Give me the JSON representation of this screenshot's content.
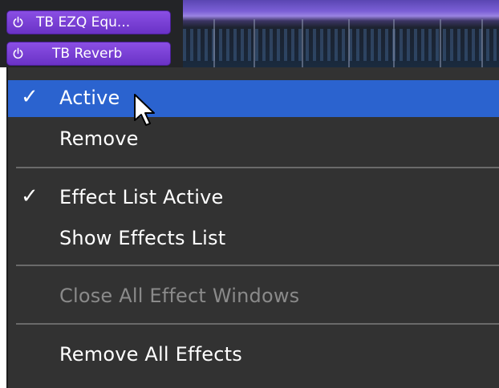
{
  "effect_slots": [
    {
      "name": "TB EZQ Equ...",
      "icon": "power-icon"
    },
    {
      "name": "TB Reverb",
      "icon": "power-icon"
    }
  ],
  "menu": {
    "items": [
      {
        "label": "Active",
        "checked": true,
        "highlighted": true,
        "enabled": true
      },
      {
        "label": "Remove",
        "checked": false,
        "enabled": true
      },
      {
        "label": "Effect List Active",
        "checked": true,
        "enabled": true
      },
      {
        "label": "Show Effects List",
        "checked": false,
        "enabled": true
      },
      {
        "label": "Close All Effect Windows",
        "checked": false,
        "enabled": false
      },
      {
        "label": "Remove All Effects",
        "checked": false,
        "enabled": true
      }
    ],
    "check_glyph": "✓"
  },
  "colors": {
    "menu_background": "#323232",
    "highlight": "#2b63cf",
    "slot_purple": "#7a40d8",
    "disabled_text": "#8a8a8a"
  }
}
